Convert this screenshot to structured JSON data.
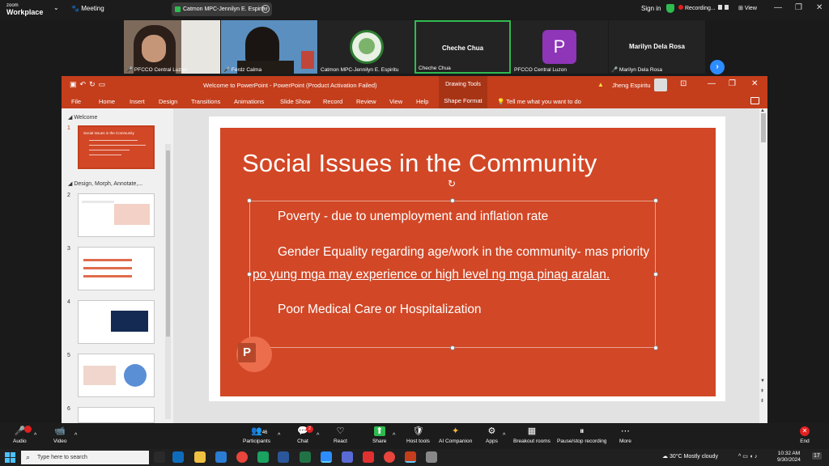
{
  "zoom": {
    "brand_top": "zoom",
    "brand_bottom": "Workplace",
    "meeting_label": "Meeting",
    "share_title": "Catmon MPC-Jennilyn E. Espiritu",
    "sign_in": "Sign in",
    "recording": "Recording...",
    "view": "View",
    "participants_tiles": [
      {
        "name": "PFCCO Central Luzon",
        "type": "video"
      },
      {
        "name": "Ferdz Calma",
        "type": "video"
      },
      {
        "name": "Catmon MPC-Jennilyn E. Espiritu",
        "type": "logo"
      },
      {
        "name": "Cheche Chua",
        "type": "name",
        "center": "Cheche Chua"
      },
      {
        "name": "PFCCO Central Luzon",
        "type": "avatar",
        "initial": "P"
      },
      {
        "name": "Marilyn Dela Rosa",
        "type": "name",
        "center": "Marilyn Dela Rosa"
      }
    ],
    "controls": [
      {
        "label": "Audio",
        "icon": "🎤"
      },
      {
        "label": "Video",
        "icon": "📹"
      },
      {
        "label": "Participants",
        "icon": "👥",
        "count": "46"
      },
      {
        "label": "Chat",
        "icon": "💬",
        "badge": "2"
      },
      {
        "label": "React",
        "icon": "♡"
      },
      {
        "label": "Share",
        "icon": "⬆"
      },
      {
        "label": "Host tools",
        "icon": "🛡"
      },
      {
        "label": "AI Companion",
        "icon": "✦"
      },
      {
        "label": "Apps",
        "icon": "⚙"
      },
      {
        "label": "Breakout rooms",
        "icon": "▦"
      },
      {
        "label": "Pause/stop recording",
        "icon": "⏸"
      },
      {
        "label": "More",
        "icon": "⋯"
      }
    ],
    "end_label": "End"
  },
  "ppt": {
    "window_title": "Welcome to PowerPoint  -  PowerPoint (Product Activation Failed)",
    "drawing_tools": "Drawing Tools",
    "user": "Jheng Espiritu",
    "tabs": [
      "File",
      "Home",
      "Insert",
      "Design",
      "Transitions",
      "Animations",
      "Slide Show",
      "Record",
      "Review",
      "View",
      "Help"
    ],
    "shape_format": "Shape Format",
    "tell_me": "Tell me what you want to do",
    "sections": [
      "Welcome",
      "Design, Morph, Annotate,..."
    ],
    "slide_numbers": [
      "1",
      "2",
      "3",
      "4",
      "5",
      "6"
    ],
    "thumb1_title": "Social Issues in the Community",
    "slide": {
      "title": "Social Issues in the Community",
      "bullet1": "Poverty - due to unemployment and inflation rate",
      "bullet2a": "Gender Equality regarding age/work in the community- mas priority",
      "bullet2b": "po yung mga may experience or high level ng mga pinag aralan.",
      "bullet3": "Poor Medical Care or Hospitalization"
    },
    "colors": {
      "accent": "#d24726",
      "ribbon": "#c43e1c"
    }
  },
  "taskbar": {
    "search_placeholder": "Type here to search",
    "weather": "30°C   Mostly cloudy",
    "time": "10:32 AM",
    "date": "9/30/2024",
    "notif": "17"
  }
}
